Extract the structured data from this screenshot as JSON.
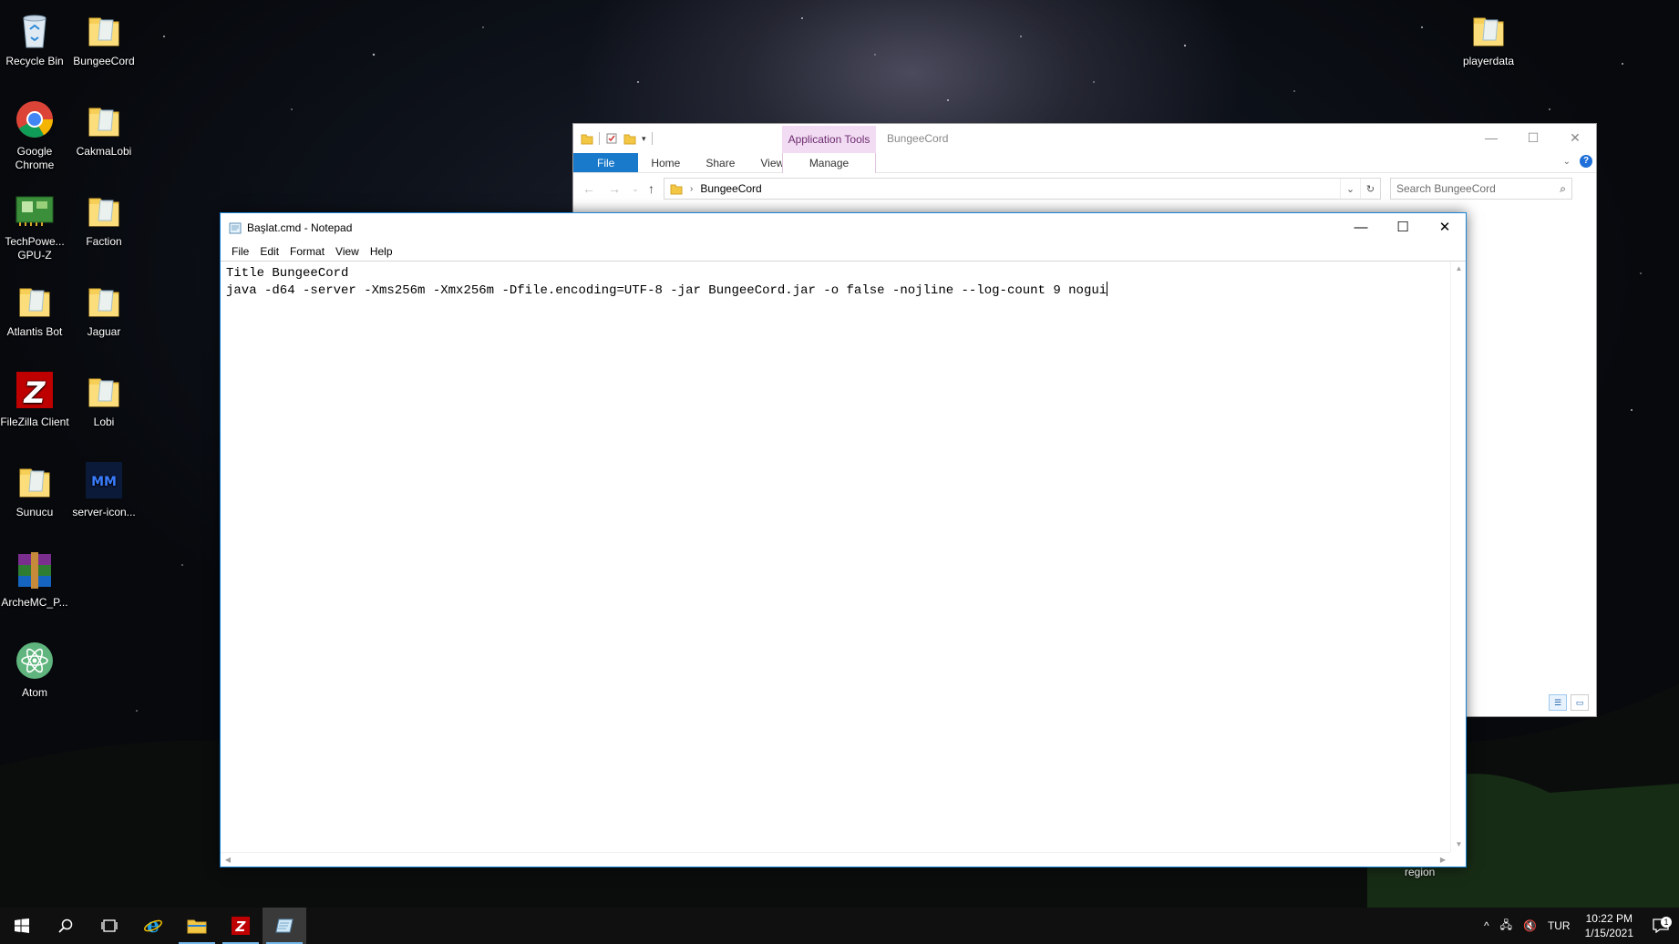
{
  "desktop": {
    "icons": [
      {
        "label": "Recycle Bin",
        "icon": "recycle-bin-icon"
      },
      {
        "label": "BungeeCord",
        "icon": "folder-icon"
      },
      {
        "label": "Google Chrome",
        "icon": "chrome-icon"
      },
      {
        "label": "CakmaLobi",
        "icon": "folder-icon"
      },
      {
        "label": "TechPowe... GPU-Z",
        "icon": "gpu-z-icon"
      },
      {
        "label": "Faction",
        "icon": "folder-icon"
      },
      {
        "label": "Atlantis Bot",
        "icon": "folder-icon"
      },
      {
        "label": "Jaguar",
        "icon": "folder-icon"
      },
      {
        "label": "FileZilla Client",
        "icon": "filezilla-icon"
      },
      {
        "label": "Lobi",
        "icon": "folder-icon"
      },
      {
        "label": "Sunucu",
        "icon": "folder-icon"
      },
      {
        "label": "server-icon...",
        "icon": "image-file-icon"
      },
      {
        "label": "ArcheMC_P...",
        "icon": "winrar-icon"
      },
      {
        "label": "Atom",
        "icon": "atom-icon"
      },
      {
        "label": "playerdata",
        "icon": "folder-icon"
      }
    ],
    "behind_label": "region"
  },
  "explorer": {
    "context_tab": "Application Tools",
    "title": "BungeeCord",
    "tabs": [
      "File",
      "Home",
      "Share",
      "View"
    ],
    "manage_tab": "Manage",
    "address": "BungeeCord",
    "search_placeholder": "Search BungeeCord"
  },
  "notepad": {
    "title": "Başlat.cmd - Notepad",
    "menu": [
      "File",
      "Edit",
      "Format",
      "View",
      "Help"
    ],
    "lines": [
      "Title BungeeCord",
      "java -d64 -server -Xms256m -Xmx256m -Dfile.encoding=UTF-8 -jar BungeeCord.jar -o false -nojline --log-count 9 nogui"
    ]
  },
  "taskbar": {
    "language": "TUR",
    "time": "10:22 PM",
    "date": "1/15/2021",
    "notification_count": "1"
  },
  "colors": {
    "file_tab": "#1979ca",
    "app_tools_bg": "#f2dcf3",
    "notepad_border": "#1883d7",
    "taskbar": "#101010"
  }
}
